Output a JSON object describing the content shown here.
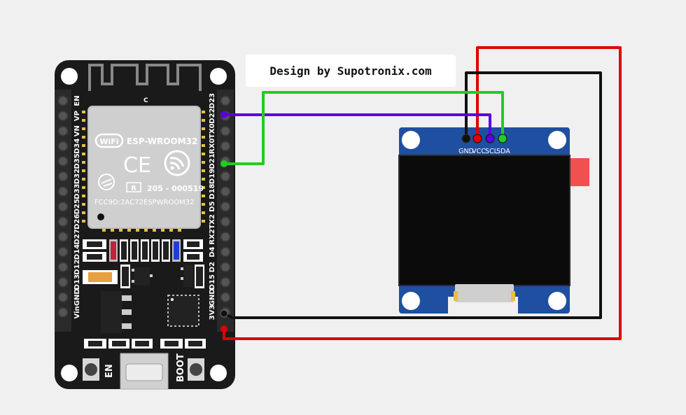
{
  "credit": "Design by Supotronix.com",
  "esp32": {
    "module_name": "ESP-WROOM32",
    "wifi_badge": "WiFi",
    "ce_mark": "CE",
    "cert_id": "205 - 000519",
    "fcc_id": "FCC9D:2AC72ESPWROOM32",
    "antenna_mark": "C",
    "left_pins": [
      "EN",
      "VP",
      "VN",
      "D34",
      "D35",
      "D32",
      "D33",
      "D25",
      "D26",
      "D27",
      "D14",
      "D12",
      "D13",
      "GND",
      "Vin"
    ],
    "right_pins": [
      "D23",
      "D22",
      "TX0",
      "RX0",
      "D21",
      "D19",
      "D18",
      "D5",
      "TX2",
      "RX2",
      "D4",
      "D2",
      "D15",
      "GND",
      "3V3"
    ],
    "en_button": "EN",
    "boot_button": "BOOT"
  },
  "oled": {
    "pins": [
      "GND",
      "VCC",
      "SCL",
      "SDA"
    ]
  },
  "colors": {
    "background": "#f0f0f0",
    "board": "#1a1a1a",
    "oled_pcb": "#1f4fa0",
    "screen": "#0b0b0b",
    "wire_vcc": "#e00000",
    "wire_gnd": "#111111",
    "wire_scl": "#5a00e0",
    "wire_sda": "#22cc22"
  }
}
